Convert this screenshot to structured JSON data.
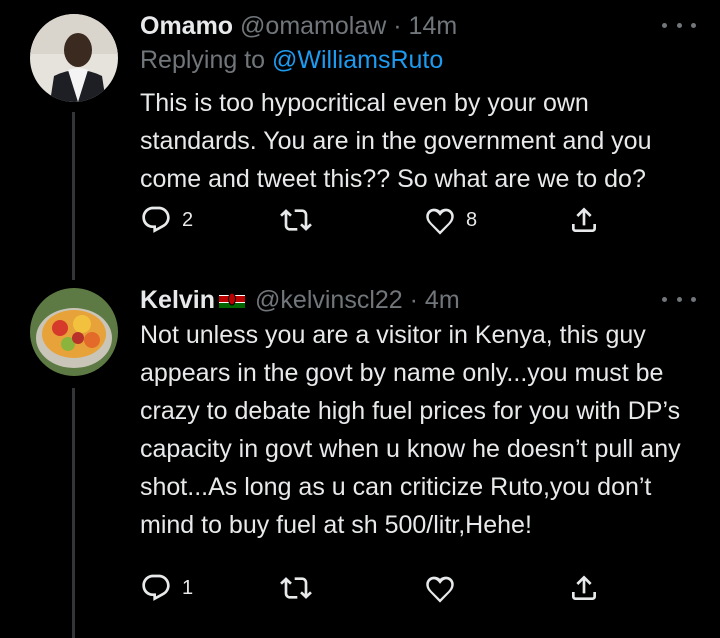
{
  "tweets": [
    {
      "name": "Omamo",
      "handle": "@omamolaw",
      "separator": "·",
      "time": "14m",
      "replying_prefix": "Replying to ",
      "replying_to": "@WilliamsRuto",
      "text": "This is too hypocritical even by your own standards. You are in the government and you come and tweet this?? So what are we to do?",
      "replies": "2",
      "retweets": "",
      "likes": "8"
    },
    {
      "name": "Kelvin",
      "handle": "@kelvinscl22",
      "separator": "·",
      "time": "4m",
      "text": "Not unless you are a visitor in Kenya, this guy appears in the govt by name only...you must be crazy to debate high fuel prices for you with DP’s capacity in govt when u know he doesn’t pull any shot...As long as u can criticize Ruto,you don’t mind to buy fuel at sh 500/litr,Hehe!",
      "replies": "1",
      "retweets": "",
      "likes": ""
    }
  ],
  "colors": {
    "background": "#000000",
    "text": "#e7e9ea",
    "muted": "#71767b",
    "link": "#1d9bf0",
    "thread_line": "#333639"
  },
  "icons": [
    "reply-icon",
    "retweet-icon",
    "like-icon",
    "share-icon",
    "more-icon",
    "kenya-flag-icon"
  ]
}
